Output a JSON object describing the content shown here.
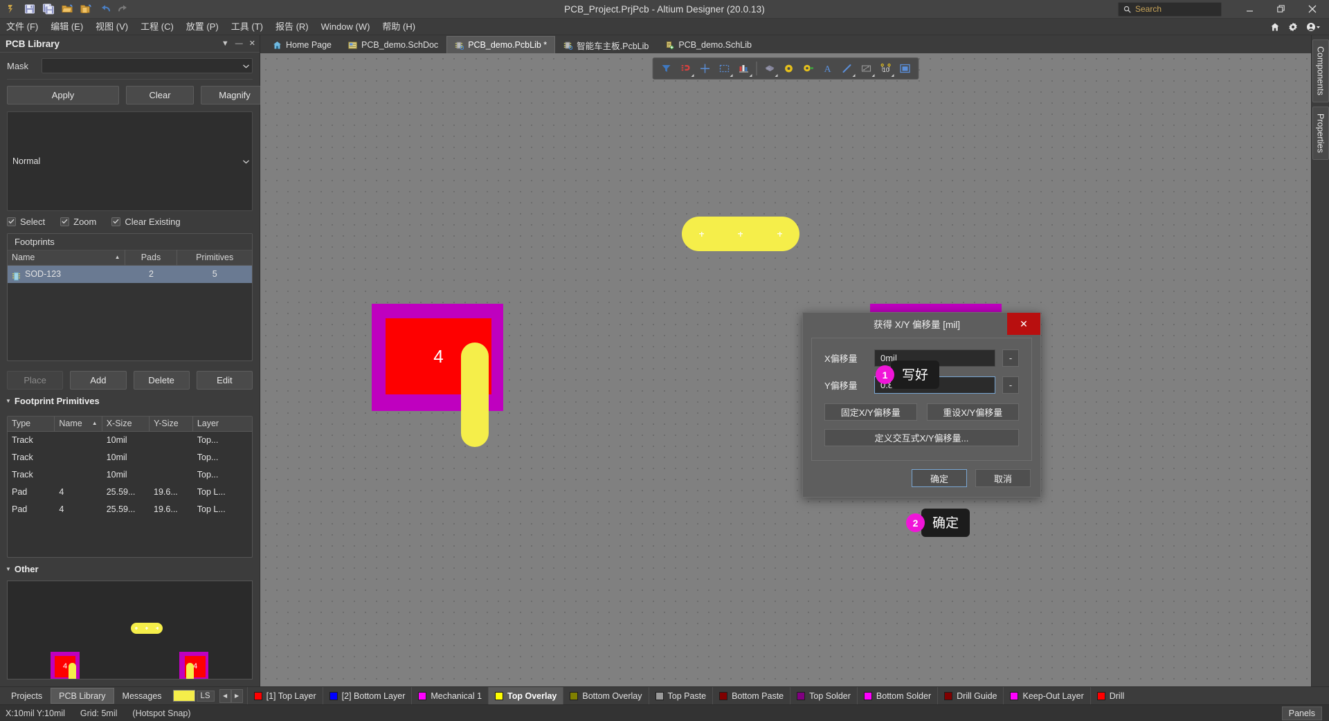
{
  "window": {
    "title": "PCB_Project.PrjPcb - Altium Designer (20.0.13)",
    "minimize_label": "–",
    "restore_label": "❐",
    "close_label": "✕"
  },
  "search": {
    "placeholder": "Search",
    "icon": "search-icon"
  },
  "quick_access": [
    {
      "name": "altium-logo-icon"
    },
    {
      "name": "save-icon"
    },
    {
      "name": "save-all-icon"
    },
    {
      "name": "open-icon"
    },
    {
      "name": "open-project-icon"
    },
    {
      "name": "undo-icon"
    },
    {
      "name": "redo-icon"
    }
  ],
  "menu": {
    "items": [
      {
        "label": "文件 (F)"
      },
      {
        "label": "编辑 (E)"
      },
      {
        "label": "视图 (V)"
      },
      {
        "label": "工程 (C)"
      },
      {
        "label": "放置 (P)"
      },
      {
        "label": "工具 (T)"
      },
      {
        "label": "报告 (R)"
      },
      {
        "label": "Window (W)"
      },
      {
        "label": "帮助 (H)"
      }
    ],
    "right_icons": [
      {
        "name": "home-icon"
      },
      {
        "name": "gear-icon"
      },
      {
        "name": "account-icon"
      }
    ]
  },
  "panel": {
    "title": "PCB Library",
    "header_buttons": [
      {
        "name": "panel-dropdown-icon",
        "glyph": "▼"
      },
      {
        "name": "panel-pin-icon",
        "glyph": "―"
      },
      {
        "name": "panel-close-icon",
        "glyph": "✕"
      }
    ],
    "mask_label": "Mask",
    "mask_value": "",
    "buttons": {
      "apply": "Apply",
      "clear": "Clear",
      "magnify": "Magnify",
      "place": "Place",
      "add": "Add",
      "delete": "Delete",
      "edit": "Edit"
    },
    "mode_value": "Normal",
    "checkboxes": [
      {
        "label": "Select",
        "checked": true
      },
      {
        "label": "Zoom",
        "checked": true
      },
      {
        "label": "Clear Existing",
        "checked": true
      }
    ],
    "footprints": {
      "caption": "Footprints",
      "columns": [
        "Name",
        "Pads",
        "Primitives"
      ],
      "sort_column": "Name",
      "rows": [
        {
          "name": "SOD-123",
          "pads": "2",
          "primitives": "5",
          "selected": true
        }
      ]
    },
    "primitives": {
      "title": "Footprint Primitives",
      "columns": [
        "Type",
        "Name",
        "X-Size",
        "Y-Size",
        "Layer"
      ],
      "sort_column": "Name",
      "rows": [
        {
          "type": "Track",
          "name": "",
          "xsize": "10mil",
          "ysize": "",
          "layer": "Top..."
        },
        {
          "type": "Track",
          "name": "",
          "xsize": "10mil",
          "ysize": "",
          "layer": "Top..."
        },
        {
          "type": "Track",
          "name": "",
          "xsize": "10mil",
          "ysize": "",
          "layer": "Top..."
        },
        {
          "type": "Pad",
          "name": "4",
          "xsize": "25.59...",
          "ysize": "19.6...",
          "layer": "Top L..."
        },
        {
          "type": "Pad",
          "name": "4",
          "xsize": "25.59...",
          "ysize": "19.6...",
          "layer": "Top L..."
        }
      ]
    },
    "other": {
      "title": "Other"
    }
  },
  "doc_tabs": [
    {
      "label": "Home Page",
      "icon": "home-page-icon",
      "active": false
    },
    {
      "label": "PCB_demo.SchDoc",
      "icon": "schdoc-icon",
      "active": false
    },
    {
      "label": "PCB_demo.PcbLib *",
      "icon": "pcblib-icon",
      "active": true
    },
    {
      "label": "智能车主板.PcbLib",
      "icon": "pcblib-icon",
      "active": false
    },
    {
      "label": "PCB_demo.SchLib",
      "icon": "schlib-icon",
      "active": false
    }
  ],
  "float_toolbar": [
    {
      "name": "filter-icon",
      "has_menu": false
    },
    {
      "name": "snap-magnet-icon",
      "has_menu": true
    },
    {
      "name": "crosshair-icon",
      "has_menu": false
    },
    {
      "name": "selection-rect-icon",
      "has_menu": true
    },
    {
      "name": "layers-chart-icon",
      "has_menu": true
    },
    {
      "name": "component-icon",
      "has_menu": true
    },
    {
      "name": "via-icon",
      "has_menu": false
    },
    {
      "name": "pad-icon",
      "has_menu": false
    },
    {
      "name": "text-string-icon",
      "has_menu": false
    },
    {
      "name": "line-icon",
      "has_menu": true
    },
    {
      "name": "dimension-icon",
      "has_menu": true
    },
    {
      "name": "coordinate-icon",
      "has_menu": true
    },
    {
      "name": "place-region-icon",
      "has_menu": false
    }
  ],
  "dialog": {
    "title": "获得 X/Y 偏移量 [mil]",
    "close_label": "✕",
    "x_label": "X偏移量",
    "x_value": "0mil",
    "y_label": "Y偏移量",
    "y_value": "0.85mm",
    "minus_label": "-",
    "fix_button": "固定X/Y偏移量",
    "reset_button": "重设X/Y偏移量",
    "interactive_button": "定义交互式X/Y偏移量...",
    "ok_button": "确定",
    "cancel_button": "取消"
  },
  "annotations": [
    {
      "number": "1",
      "text": "写好",
      "color": "#f015d8"
    },
    {
      "number": "2",
      "text": "确定",
      "color": "#f015d8"
    }
  ],
  "pcb_objects": {
    "top_pad_label": "",
    "left_component_label": "4",
    "right_component_label": "4",
    "preview_left_label": "4",
    "preview_right_label": "4"
  },
  "right_rail": [
    {
      "label": "Components"
    },
    {
      "label": "Properties"
    }
  ],
  "panel_tabs": [
    {
      "label": "Projects",
      "active": false
    },
    {
      "label": "PCB Library",
      "active": true
    },
    {
      "label": "Messages",
      "active": false
    }
  ],
  "layer_bar": {
    "ls_label": "LS",
    "ls_color": "#f5ee4a",
    "prev_glyph": "◀",
    "next_glyph": "▶",
    "layers": [
      {
        "label": "[1] Top Layer",
        "color": "#ff0000",
        "active": false
      },
      {
        "label": "[2] Bottom Layer",
        "color": "#0000ff",
        "active": false
      },
      {
        "label": "Mechanical 1",
        "color": "#ff00ff",
        "active": false
      },
      {
        "label": "Top Overlay",
        "color": "#ffff00",
        "active": true
      },
      {
        "label": "Bottom Overlay",
        "color": "#808000",
        "active": false
      },
      {
        "label": "Top Paste",
        "color": "#9a9a9a",
        "active": false
      },
      {
        "label": "Bottom Paste",
        "color": "#800000",
        "active": false
      },
      {
        "label": "Top Solder",
        "color": "#800080",
        "active": false
      },
      {
        "label": "Bottom Solder",
        "color": "#ff00ff",
        "active": false
      },
      {
        "label": "Drill Guide",
        "color": "#800000",
        "active": false
      },
      {
        "label": "Keep-Out Layer",
        "color": "#ff00ff",
        "active": false
      },
      {
        "label": "Drill",
        "color": "#ff0000",
        "active": false
      }
    ]
  },
  "status": {
    "coords": "X:10mil Y:10mil",
    "grid": "Grid: 5mil",
    "snap": "(Hotspot Snap)",
    "panels_button": "Panels"
  }
}
